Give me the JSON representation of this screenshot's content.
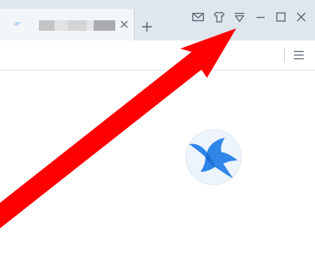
{
  "tab": {
    "title": "",
    "favicon": "thunder-bird-icon",
    "close_icon": "close-icon"
  },
  "new_tab_icon": "plus-icon",
  "window_controls": [
    {
      "name": "mail-icon"
    },
    {
      "name": "skin-icon"
    },
    {
      "name": "dropdown-menu-icon"
    },
    {
      "name": "minimize-icon"
    },
    {
      "name": "maximize-icon"
    },
    {
      "name": "close-window-icon"
    }
  ],
  "toolbar": {
    "menu_icon": "hamburger-menu-icon"
  },
  "logo": "thunder-bird-logo",
  "annotation": {
    "type": "red-arrow",
    "color": "#ff0000",
    "points_to": "dropdown-menu-icon"
  },
  "colors": {
    "titlebar": "#dfe6ee",
    "tab_active": "#f3f6f9",
    "icon": "#5b6573",
    "logo_blue": "#2f86e8",
    "logo_bg": "#eef4fb",
    "arrow": "#ff0000"
  }
}
